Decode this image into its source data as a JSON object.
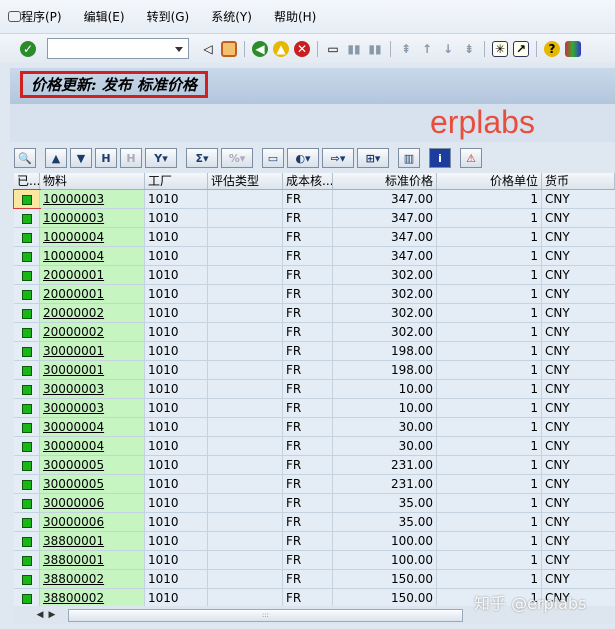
{
  "menu": {
    "items": [
      "程序(P)",
      "编辑(E)",
      "转到(G)",
      "系统(Y)",
      "帮助(H)"
    ]
  },
  "toolbar": {
    "command_value": "",
    "icons": [
      "enter-icon",
      "back-icon",
      "save-icon",
      "back-green-icon",
      "exit-icon",
      "cancel-icon",
      "print-icon",
      "find-icon",
      "find-next-icon",
      "first-page-icon",
      "prev-page-icon",
      "next-page-icon",
      "last-page-icon",
      "new-session-icon",
      "shortcut-icon",
      "help-icon",
      "layout-icon"
    ]
  },
  "title": "价格更新: 发布 标准价格",
  "watermark": "erplabs",
  "footer_watermark": "知乎 @erplabs",
  "columns": [
    "已...",
    "物料",
    "工厂",
    "评估类型",
    "成本核...",
    "标准价格",
    "价格单位",
    "货币"
  ],
  "rows": [
    [
      "10000003",
      "1010",
      "",
      "FR",
      "347.00",
      "1",
      "CNY"
    ],
    [
      "10000003",
      "1010",
      "",
      "FR",
      "347.00",
      "1",
      "CNY"
    ],
    [
      "10000004",
      "1010",
      "",
      "FR",
      "347.00",
      "1",
      "CNY"
    ],
    [
      "10000004",
      "1010",
      "",
      "FR",
      "347.00",
      "1",
      "CNY"
    ],
    [
      "20000001",
      "1010",
      "",
      "FR",
      "302.00",
      "1",
      "CNY"
    ],
    [
      "20000001",
      "1010",
      "",
      "FR",
      "302.00",
      "1",
      "CNY"
    ],
    [
      "20000002",
      "1010",
      "",
      "FR",
      "302.00",
      "1",
      "CNY"
    ],
    [
      "20000002",
      "1010",
      "",
      "FR",
      "302.00",
      "1",
      "CNY"
    ],
    [
      "30000001",
      "1010",
      "",
      "FR",
      "198.00",
      "1",
      "CNY"
    ],
    [
      "30000001",
      "1010",
      "",
      "FR",
      "198.00",
      "1",
      "CNY"
    ],
    [
      "30000003",
      "1010",
      "",
      "FR",
      "10.00",
      "1",
      "CNY"
    ],
    [
      "30000003",
      "1010",
      "",
      "FR",
      "10.00",
      "1",
      "CNY"
    ],
    [
      "30000004",
      "1010",
      "",
      "FR",
      "30.00",
      "1",
      "CNY"
    ],
    [
      "30000004",
      "1010",
      "",
      "FR",
      "30.00",
      "1",
      "CNY"
    ],
    [
      "30000005",
      "1010",
      "",
      "FR",
      "231.00",
      "1",
      "CNY"
    ],
    [
      "30000005",
      "1010",
      "",
      "FR",
      "231.00",
      "1",
      "CNY"
    ],
    [
      "30000006",
      "1010",
      "",
      "FR",
      "35.00",
      "1",
      "CNY"
    ],
    [
      "30000006",
      "1010",
      "",
      "FR",
      "35.00",
      "1",
      "CNY"
    ],
    [
      "38800001",
      "1010",
      "",
      "FR",
      "100.00",
      "1",
      "CNY"
    ],
    [
      "38800001",
      "1010",
      "",
      "FR",
      "100.00",
      "1",
      "CNY"
    ],
    [
      "38800002",
      "1010",
      "",
      "FR",
      "150.00",
      "1",
      "CNY"
    ],
    [
      "38800002",
      "1010",
      "",
      "FR",
      "150.00",
      "1",
      "CNY"
    ]
  ],
  "colors": {
    "status_green": "#19b519",
    "material_bg": "#c6f5c2",
    "title_border": "#d21f1f",
    "watermark": "#e94e3c"
  }
}
